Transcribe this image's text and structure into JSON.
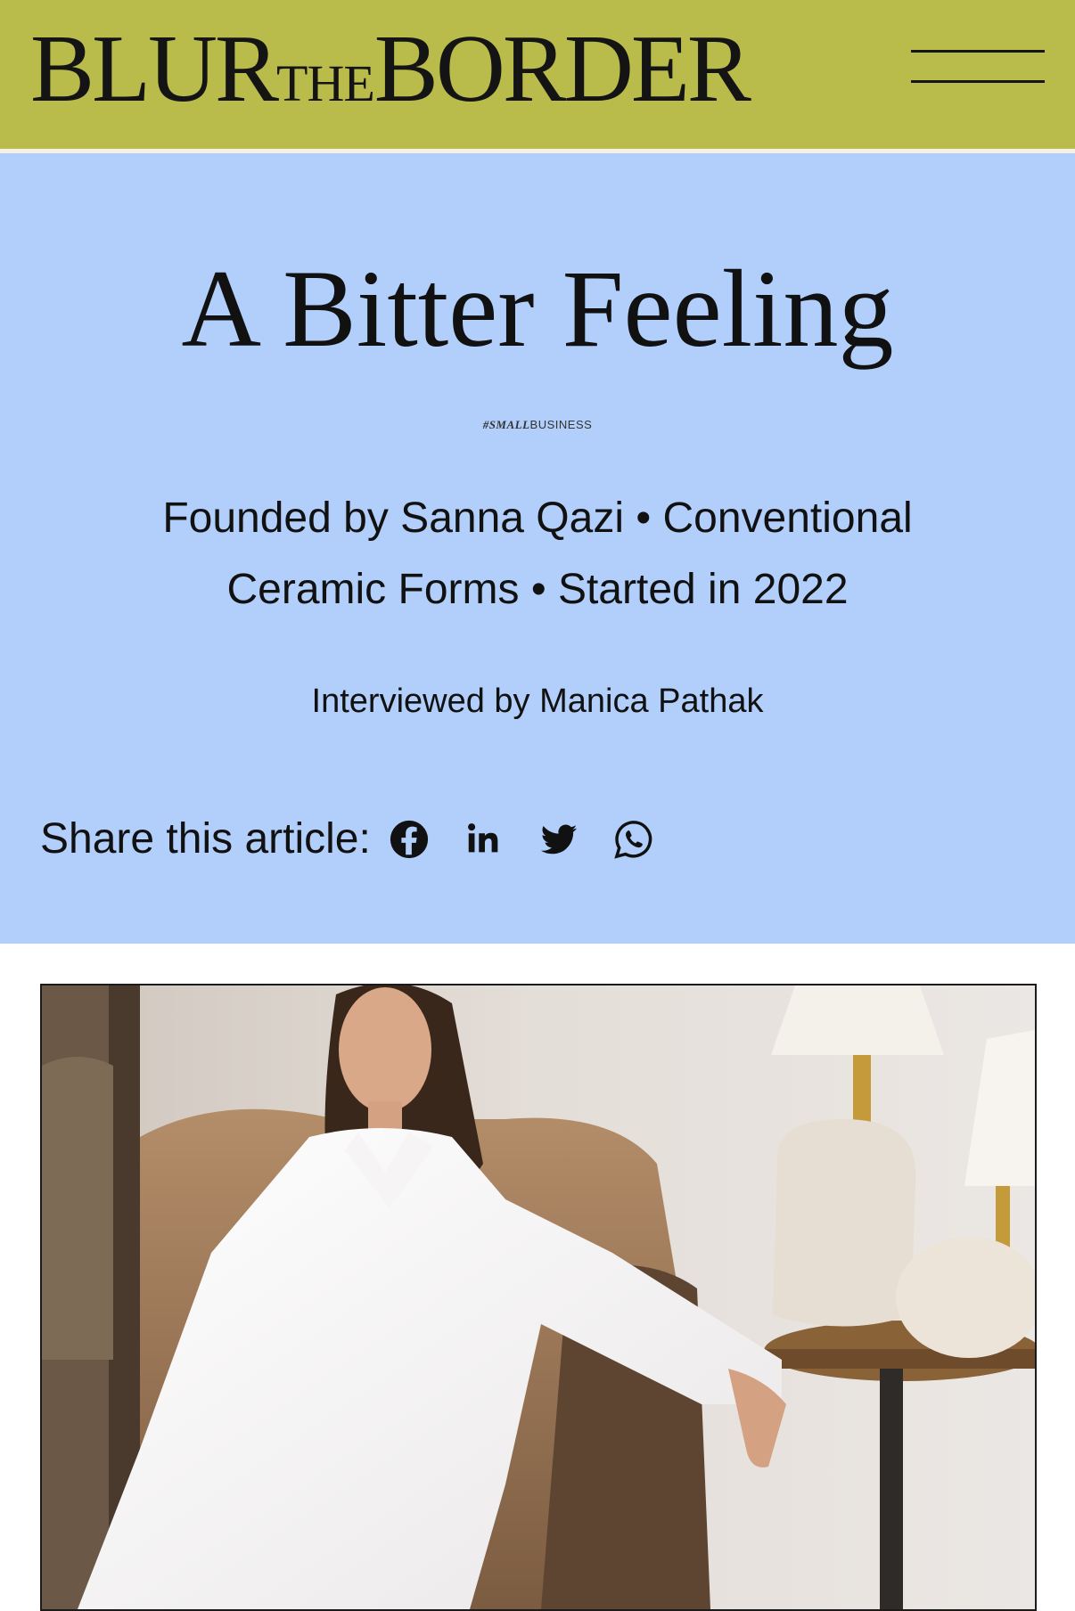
{
  "header": {
    "logo": {
      "part1": "BLUR",
      "part2": "THE",
      "part3": "BORDER"
    },
    "menu_icon": "hamburger-menu-icon",
    "background_color": "#b9bb4b"
  },
  "article": {
    "title": "A Bitter Feeling",
    "category": {
      "hash": "#SMALL",
      "label": "BUSINESS"
    },
    "summary_line1": "Founded by Sanna Qazi • Conventional",
    "summary_line2": "Ceramic Forms • Started in 2022",
    "interviewer": "Interviewed by Manica Pathak",
    "hero_background_color": "#b1cffa"
  },
  "share": {
    "label": "Share this article:",
    "icons": [
      "facebook-icon",
      "linkedin-icon",
      "twitter-icon",
      "whatsapp-icon"
    ]
  },
  "photo": {
    "subject": "woman in white shirt dress seated in a brown armchair beside ceramic lamps"
  }
}
